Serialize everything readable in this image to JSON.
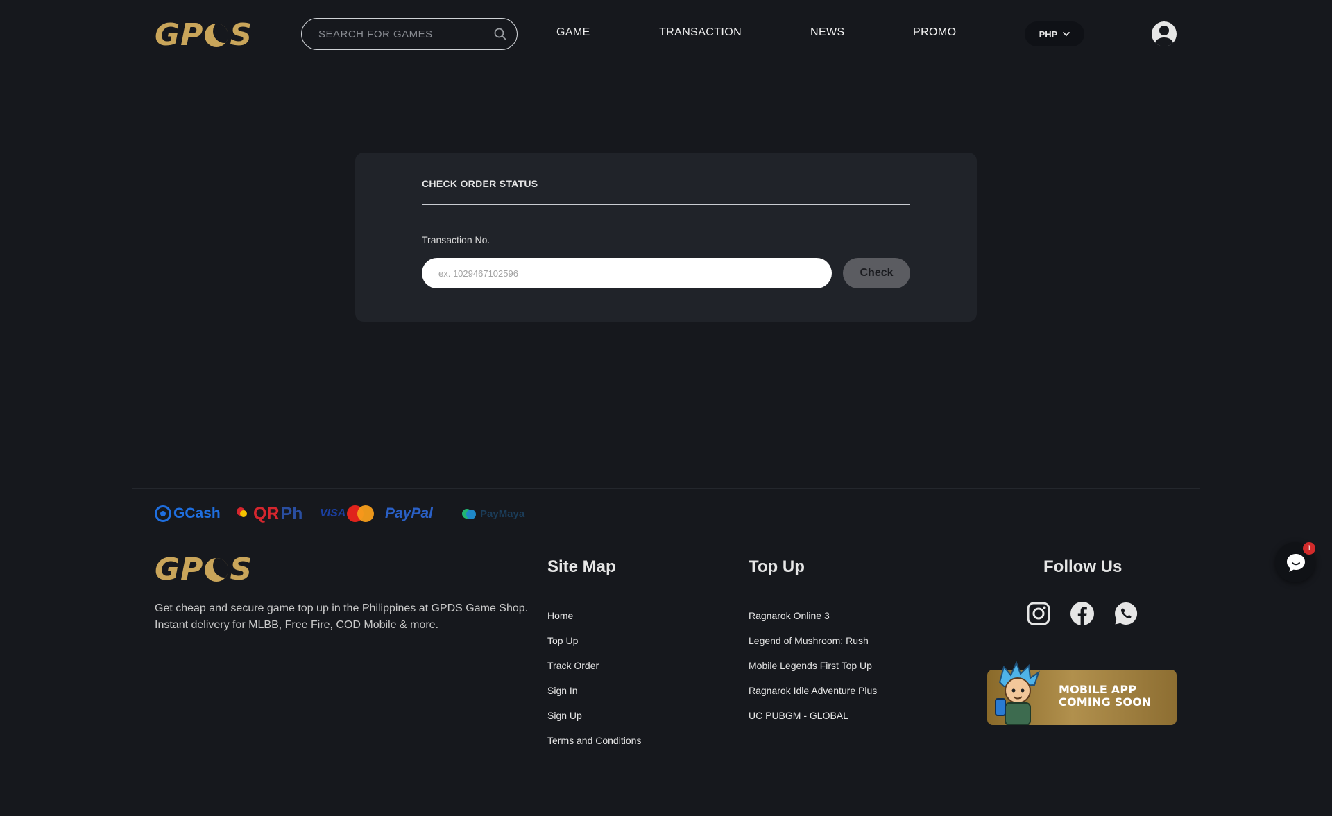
{
  "brand": {
    "logo_text_left": "GP",
    "logo_text_right": "S"
  },
  "search": {
    "placeholder": "SEARCH FOR GAMES"
  },
  "nav": {
    "items": [
      {
        "label": "GAME"
      },
      {
        "label": "TRANSACTION"
      },
      {
        "label": "NEWS"
      },
      {
        "label": "PROMO"
      }
    ]
  },
  "currency": {
    "selected": "PHP"
  },
  "order_check": {
    "title": "CHECK ORDER STATUS",
    "field_label": "Transaction No.",
    "input_placeholder": "ex. 1029467102596",
    "input_value": "",
    "button_label": "Check"
  },
  "payments": {
    "gcash": "GCash",
    "qrph_left": "QR",
    "qrph_right": "Ph",
    "visa": "VISA",
    "paypal": "PayPal",
    "paymaya": "PayMaya"
  },
  "footer": {
    "about": "Get cheap and secure game top up in the Philippines at GPDS Game Shop. Instant delivery for MLBB, Free Fire, COD Mobile & more.",
    "site_map": {
      "title": "Site Map",
      "links": [
        "Home",
        "Top Up",
        "Track Order",
        "Sign In",
        "Sign Up",
        "Terms and Conditions"
      ]
    },
    "top_up": {
      "title": "Top Up",
      "links": [
        "Ragnarok Online 3",
        "Legend of Mushroom: Rush",
        "Mobile Legends First Top Up",
        "Ragnarok Idle Adventure Plus",
        "UC PUBGM - GLOBAL"
      ]
    },
    "follow": {
      "title": "Follow Us",
      "icons": [
        "instagram-icon",
        "facebook-icon",
        "whatsapp-icon"
      ]
    },
    "app_banner": {
      "line1": "MOBILE APP",
      "line2": "COMING SOON"
    }
  },
  "chat": {
    "badge_count": "1"
  },
  "colors": {
    "background": "#16181d",
    "card": "#202329",
    "brand_gold": "#c9a55a",
    "button_gray": "#5b5c61"
  }
}
